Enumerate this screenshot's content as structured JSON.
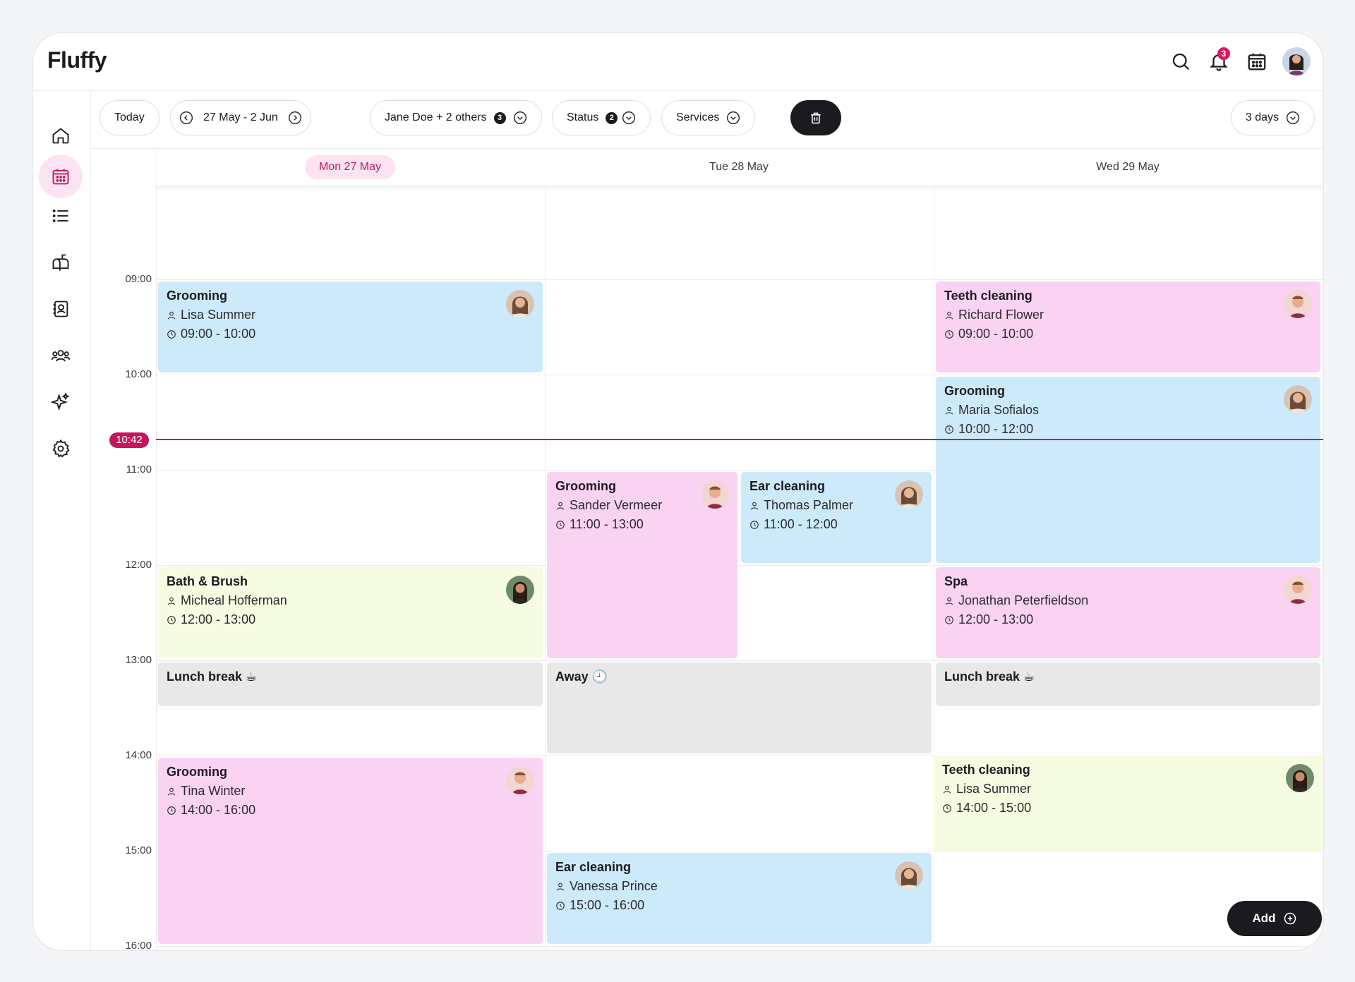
{
  "app": {
    "logo": "Fluffy",
    "notification_count": "3"
  },
  "toolbar": {
    "today_label": "Today",
    "date_range": "27 May - 2 Jun",
    "staff_label": "Jane Doe + 2 others",
    "staff_count": "3",
    "status_label": "Status",
    "status_count": "2",
    "services_label": "Services",
    "view_label": "3 days"
  },
  "days": [
    {
      "label": "Mon 27 May",
      "today": true
    },
    {
      "label": "Tue 28 May",
      "today": false
    },
    {
      "label": "Wed 29 May",
      "today": false
    }
  ],
  "times": [
    "09:00",
    "10:00",
    "11:00",
    "12:00",
    "13:00",
    "14:00",
    "15:00",
    "16:00"
  ],
  "now": "10:42",
  "events": {
    "mon_grooming": {
      "title": "Grooming",
      "client": "Lisa Summer",
      "time": "09:00 - 10:00"
    },
    "mon_bath": {
      "title": "Bath & Brush",
      "client": "Micheal Hofferman",
      "time": "12:00 - 13:00"
    },
    "mon_lunch": {
      "title": "Lunch break ☕"
    },
    "mon_grooming2": {
      "title": "Grooming",
      "client": "Tina Winter",
      "time": "14:00 - 16:00"
    },
    "tue_grooming": {
      "title": "Grooming",
      "client": "Sander Vermeer",
      "time": "11:00 - 13:00"
    },
    "tue_ear": {
      "title": "Ear cleaning",
      "client": "Thomas Palmer",
      "time": "11:00 - 12:00"
    },
    "tue_away": {
      "title": "Away 🕘"
    },
    "tue_ear2": {
      "title": "Ear cleaning",
      "client": "Vanessa Prince",
      "time": "15:00 - 16:00"
    },
    "wed_teeth": {
      "title": "Teeth cleaning",
      "client": "Richard Flower",
      "time": "09:00 - 10:00"
    },
    "wed_grooming": {
      "title": "Grooming",
      "client": "Maria Sofialos",
      "time": "10:00 - 12:00"
    },
    "wed_spa": {
      "title": "Spa",
      "client": "Jonathan Peterfieldson",
      "time": "12:00 - 13:00"
    },
    "wed_lunch": {
      "title": "Lunch break ☕"
    },
    "wed_teeth2": {
      "title": "Teeth cleaning",
      "client": "Lisa Summer",
      "time": "14:00 - 15:00"
    }
  },
  "add_button": {
    "label": "Add"
  },
  "icons": [
    "search-icon",
    "bell-icon",
    "calendar-icon",
    "home-icon",
    "list-icon",
    "mailbox-icon",
    "contacts-icon",
    "team-icon",
    "sparkle-icon",
    "settings-icon",
    "trash-icon",
    "plus-circle-icon"
  ],
  "colors": {
    "accent": "#c2185b",
    "blue_event": "#cdeafb",
    "pink_event": "#fbd3f2",
    "lime_event": "#f6fce1",
    "gray_event": "#e8e8e8"
  }
}
